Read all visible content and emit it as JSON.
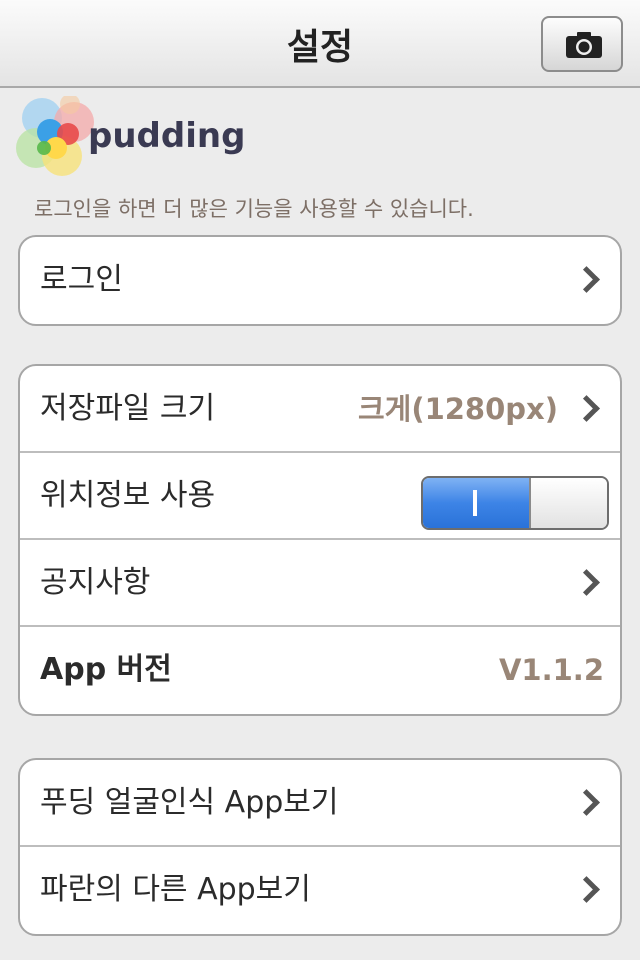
{
  "header": {
    "title": "설정",
    "camera_icon": "camera-icon"
  },
  "brand": {
    "logo_text": "pudding",
    "login_hint": "로그인을 하면 더 많은 기능을 사용할 수 있습니다."
  },
  "login": {
    "label": "로그인"
  },
  "settings": {
    "file_size_label": "저장파일 크기",
    "file_size_value": "크게(1280px)",
    "location_label": "위치정보 사용",
    "location_enabled": true,
    "location_toggle_text": "I",
    "notice_label": "공지사항",
    "version_label": "App 버전",
    "version_value": "V1.1.2"
  },
  "apps": {
    "pudding_face_label": "푸딩 얼굴인식 App보기",
    "paran_other_label": "파란의 다른 App보기"
  },
  "colors": {
    "accent_blue": "#3d84e6",
    "value_brown": "#998677",
    "background": "#ececec"
  }
}
